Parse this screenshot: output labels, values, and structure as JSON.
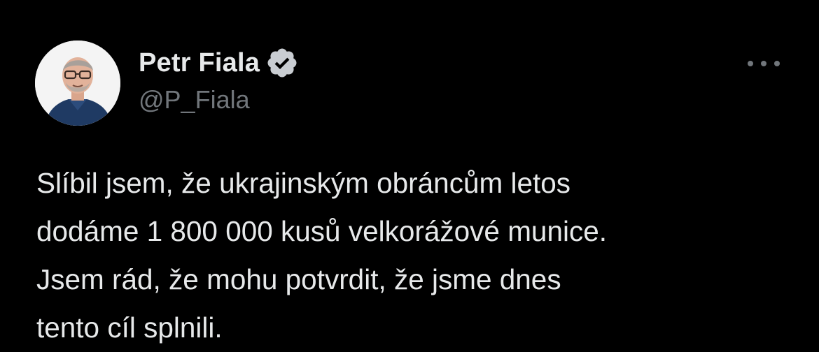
{
  "author": {
    "display_name": "Petr Fiala",
    "handle": "@P_Fiala",
    "verified": true,
    "avatar_icon": "profile-photo"
  },
  "menu": {
    "icon": "more-options-icon"
  },
  "tweet": {
    "lines": [
      "Slíbil jsem, že ukrajinským obráncům letos",
      "dodáme 1 800 000 kusů velkorážové munice.",
      "Jsem rád, že mohu potvrdit, že jsme dnes",
      "tento cíl splnili."
    ]
  },
  "colors": {
    "background": "#000000",
    "text": "#e7e9ea",
    "secondary_text": "#71767b",
    "verified_badge": "#c9cdd2"
  }
}
